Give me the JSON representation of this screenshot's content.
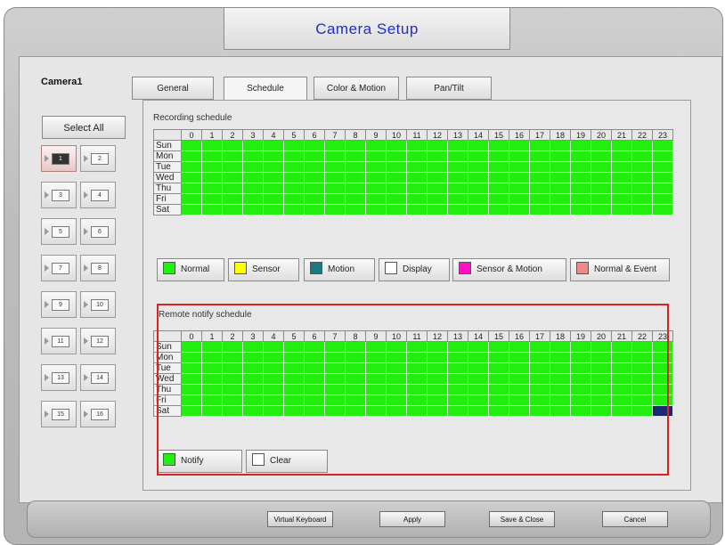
{
  "title": "Camera Setup",
  "camera_label": "Camera1",
  "tabs": [
    "General",
    "Schedule",
    "Color & Motion",
    "Pan/Tilt"
  ],
  "active_tab": "Schedule",
  "select_all": "Select All",
  "channels": [
    "1",
    "2",
    "3",
    "4",
    "5",
    "6",
    "7",
    "8",
    "9",
    "10",
    "11",
    "12",
    "13",
    "14",
    "15",
    "16"
  ],
  "selected_channel": "1",
  "recording": {
    "label": "Recording schedule",
    "hours": [
      "0",
      "1",
      "2",
      "3",
      "4",
      "5",
      "6",
      "7",
      "8",
      "9",
      "10",
      "11",
      "12",
      "13",
      "14",
      "15",
      "16",
      "17",
      "18",
      "19",
      "20",
      "21",
      "22",
      "23"
    ],
    "days": [
      "Sun",
      "Mon",
      "Tue",
      "Wed",
      "Thu",
      "Fri",
      "Sat"
    ]
  },
  "legend": [
    {
      "label": "Normal",
      "color": "#22ee10"
    },
    {
      "label": "Sensor",
      "color": "#ffff00"
    },
    {
      "label": "Motion",
      "color": "#1a7a80"
    },
    {
      "label": "Display",
      "color": "#ffffff"
    },
    {
      "label": "Sensor & Motion",
      "color": "#ff10c8"
    },
    {
      "label": "Normal & Event",
      "color": "#f08a8a"
    }
  ],
  "notify": {
    "label": "Remote notify schedule",
    "hours": [
      "0",
      "1",
      "2",
      "3",
      "4",
      "5",
      "6",
      "7",
      "8",
      "9",
      "10",
      "11",
      "12",
      "13",
      "14",
      "15",
      "16",
      "17",
      "18",
      "19",
      "20",
      "21",
      "22",
      "23"
    ],
    "days": [
      "Sun",
      "Mon",
      "Tue",
      "Wed",
      "Thu",
      "Fri",
      "Sat"
    ],
    "notify_label": "Notify",
    "clear_label": "Clear"
  },
  "footer": {
    "virtual_keyboard": "Virtual Keyboard",
    "apply": "Apply",
    "save_close": "Save & Close",
    "cancel": "Cancel"
  }
}
